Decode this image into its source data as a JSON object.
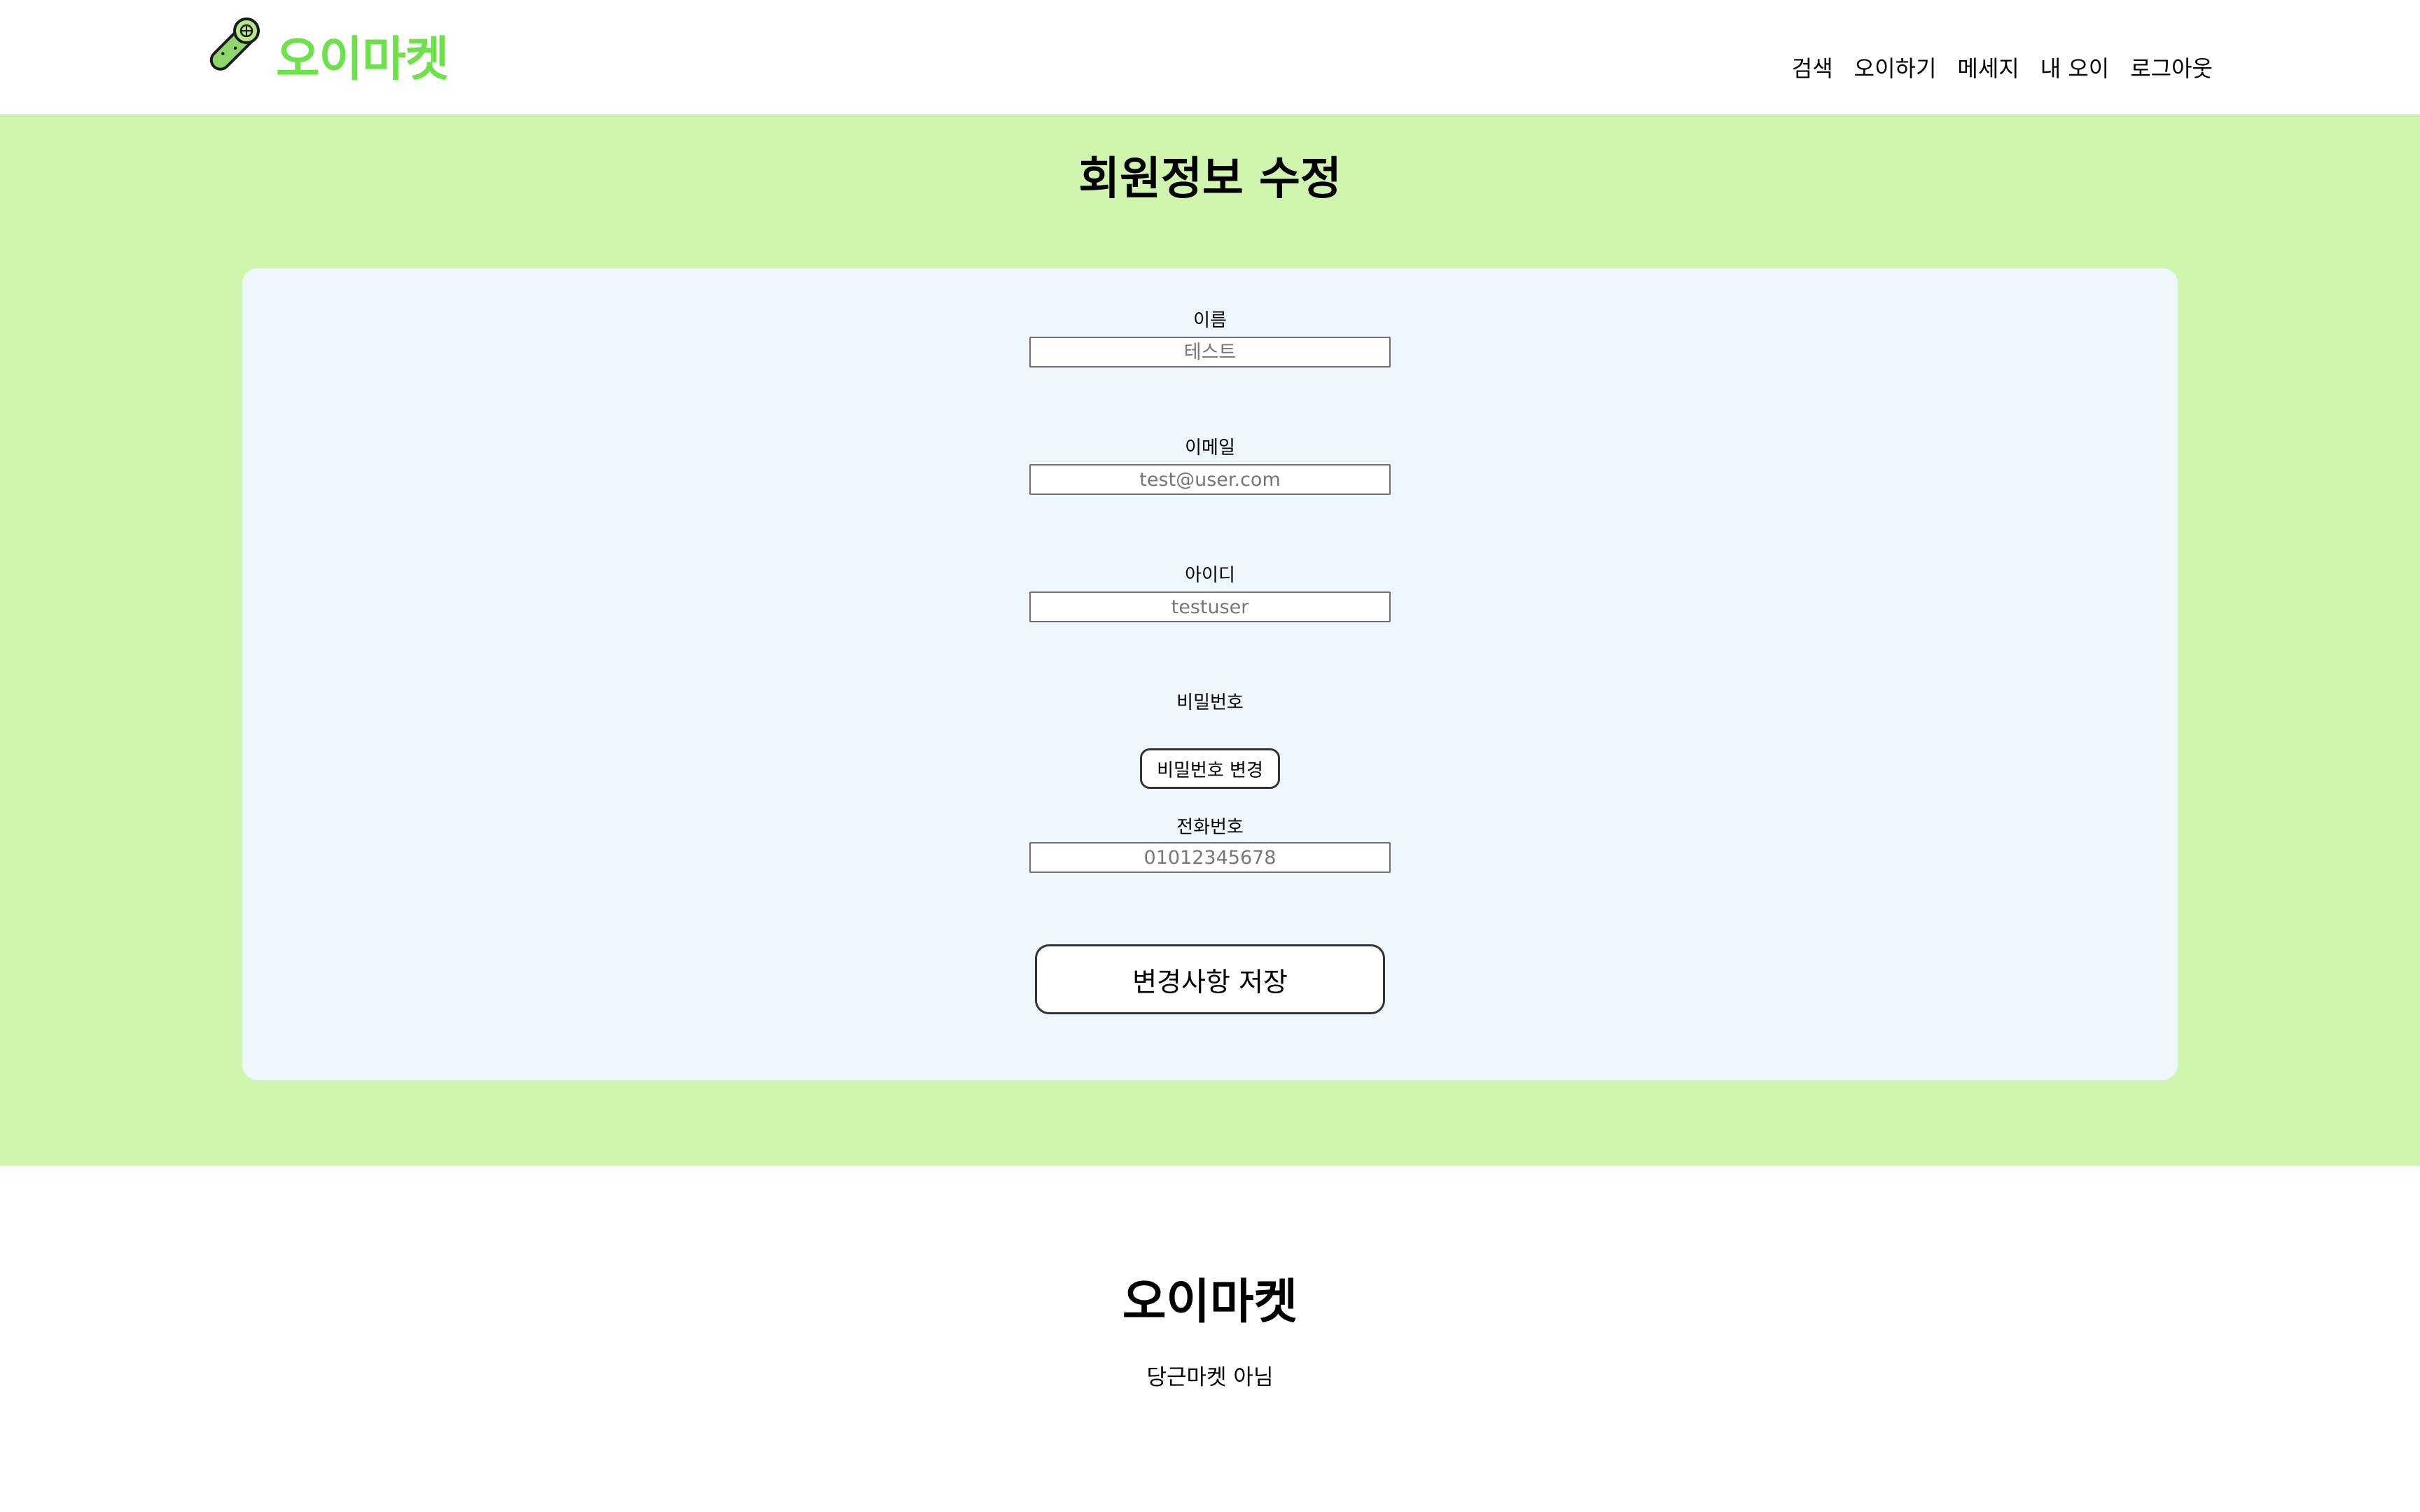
{
  "header": {
    "logo_text": "오이마켓",
    "logo_icon": "cucumber-icon",
    "nav": [
      {
        "label": "검색"
      },
      {
        "label": "오이하기"
      },
      {
        "label": "메세지"
      },
      {
        "label": "내 오이"
      },
      {
        "label": "로그아웃"
      }
    ]
  },
  "main": {
    "title": "회원정보 수정",
    "fields": {
      "name": {
        "label": "이름",
        "placeholder": "테스트"
      },
      "email": {
        "label": "이메일",
        "placeholder": "test@user.com"
      },
      "username": {
        "label": "아이디",
        "placeholder": "testuser"
      },
      "password": {
        "label": "비밀번호",
        "button": "비밀번호 변경"
      },
      "phone": {
        "label": "전화번호",
        "placeholder": "01012345678"
      }
    },
    "save_button": "변경사항 저장"
  },
  "footer": {
    "title": "오이마켓",
    "subtitle": "당근마켓 아님"
  },
  "colors": {
    "brand": "#6ee04a",
    "main_bg": "#cff5ae",
    "card_bg": "#eff7fe"
  }
}
